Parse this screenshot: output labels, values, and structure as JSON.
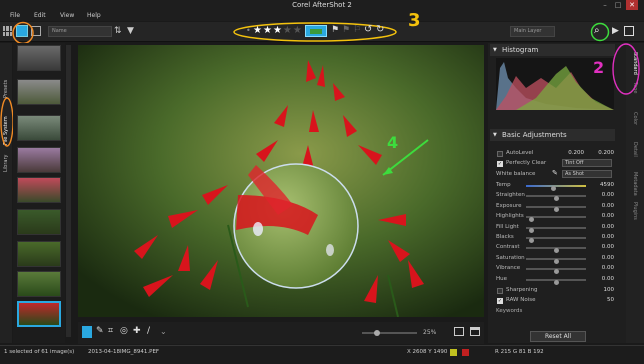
{
  "app": {
    "title": "Corel AfterShot 2"
  },
  "menu": [
    "File",
    "Edit",
    "View",
    "Help"
  ],
  "toolbar": {
    "sort_label": "Name",
    "view_label": "Main Layer",
    "rating": 3,
    "max_rating": 5,
    "accent": "#2aa8e0"
  },
  "left_tabs": [
    "File System",
    "Library",
    "Presets"
  ],
  "right_tabs": [
    "Standard",
    "Tone",
    "Color",
    "Detail",
    "Metadata",
    "Plugins"
  ],
  "histogram": {
    "title": "Histogram"
  },
  "adjustments": {
    "title": "Basic Adjustments",
    "autolevel": {
      "label": "AutoLevel",
      "v1": "0.200",
      "v2": "0.200"
    },
    "perfectly_clear": {
      "label": "Perfectly Clear",
      "value": "Tint Off"
    },
    "white_balance": {
      "label": "White balance",
      "value": "As Shot"
    },
    "sliders": [
      {
        "label": "Temp",
        "value": "4590",
        "pos": 0.45
      },
      {
        "label": "Straighten",
        "value": "0.00",
        "pos": 0.5
      },
      {
        "label": "Exposure",
        "value": "0.00",
        "pos": 0.5
      },
      {
        "label": "Highlights",
        "value": "0.00",
        "pos": 0.05
      },
      {
        "label": "Fill Light",
        "value": "0.00",
        "pos": 0.05
      },
      {
        "label": "Blacks",
        "value": "0.00",
        "pos": 0.05
      },
      {
        "label": "Contrast",
        "value": "0.00",
        "pos": 0.5
      },
      {
        "label": "Saturation",
        "value": "0.00",
        "pos": 0.5
      },
      {
        "label": "Vibrance",
        "value": "0.00",
        "pos": 0.5
      },
      {
        "label": "Hue",
        "value": "0.00",
        "pos": 0.5
      }
    ],
    "sharpening": {
      "label": "Sharpening",
      "value": "100"
    },
    "raw_noise": {
      "label": "RAW Noise",
      "value": "50"
    },
    "keywords_label": "Keywords",
    "reset_label": "Reset All"
  },
  "zoom": {
    "label": "25%",
    "level": 0.25
  },
  "status": {
    "selection": "1 selected of 61 image(s)",
    "date": "2013-04-18",
    "filename": "IMG_8941.PEF",
    "dims": "X 2608 Y 1490",
    "rgb": "R 215  G 81  B 192"
  },
  "callouts": [
    "1",
    "2",
    "3",
    "4"
  ]
}
